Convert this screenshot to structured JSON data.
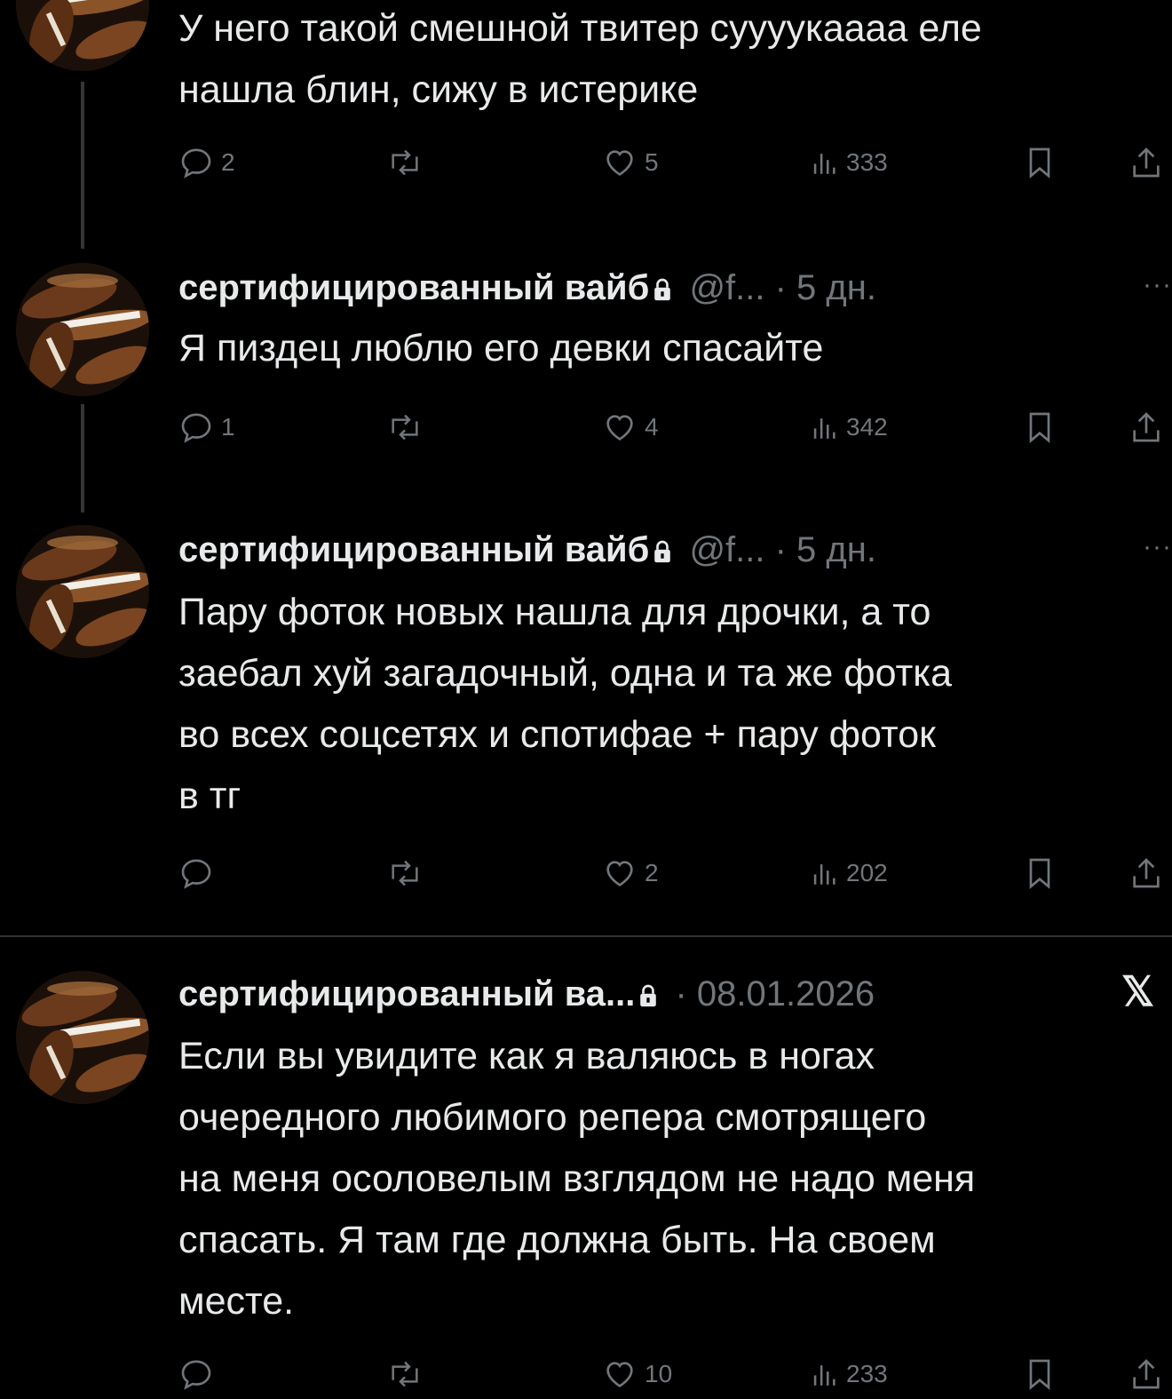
{
  "tweets": [
    {
      "text_lines": [
        "У него такой смешной твитер суууукаааа еле",
        "нашла блин, сижу в истерике"
      ],
      "actions": {
        "replies": "2",
        "retweets": "",
        "likes": "5",
        "views": "333"
      }
    },
    {
      "name": "сертифицированный вайб",
      "handle": "@f...",
      "time": "· 5 дн.",
      "more": "···",
      "text_lines": [
        "Я пиздец люблю его девки спасайте"
      ],
      "actions": {
        "replies": "1",
        "retweets": "",
        "likes": "4",
        "views": "342"
      }
    },
    {
      "name": "сертифицированный вайб",
      "handle": "@f...",
      "time": "· 5 дн.",
      "more": "···",
      "text_lines": [
        "Пару фоток новых нашла для дрочки, а то",
        "заебал хуй загадочный, одна и та же фотка",
        "во всех соцсетях и спотифае + пару фоток",
        "в тг"
      ],
      "actions": {
        "replies": "",
        "retweets": "",
        "likes": "2",
        "views": "202"
      }
    },
    {
      "name": "сертифицированный ва...",
      "time": "· 08.01.2026",
      "x_logo": "𝕏",
      "text_lines": [
        "Если вы увидите как я валяюсь в ногах",
        "очередного любимого репера смотрящего",
        "на меня осоловелым взглядом не надо меня",
        "спасать. Я там где должна быть. На своем",
        "месте."
      ],
      "actions": {
        "replies": "",
        "retweets": "",
        "likes": "10",
        "views": "233"
      }
    }
  ],
  "colors": {
    "background": "#000000",
    "text": "#e7e9ea",
    "muted": "#71767b",
    "divider": "#2f3336"
  }
}
